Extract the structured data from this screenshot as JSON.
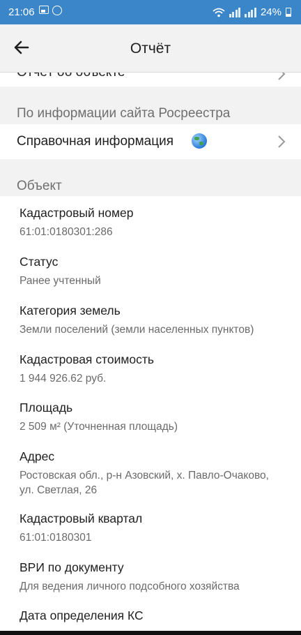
{
  "status_bar": {
    "time": "21:06",
    "battery": "24%",
    "icons": [
      "image-icon",
      "whatsapp-icon",
      "wifi-icon",
      "signal-icon",
      "battery-icon"
    ]
  },
  "app_bar": {
    "title": "Отчёт",
    "back_icon": "arrow-left-icon"
  },
  "partial_row": {
    "label": "Отчёт об объекте"
  },
  "section_rosreestr": {
    "header": "По информации сайта Росреестра",
    "item_label": "Справочная информация",
    "item_icon": "globe-icon"
  },
  "section_object": {
    "header": "Объект",
    "fields": [
      {
        "label": "Кадастровый номер",
        "value": "61:01:0180301:286"
      },
      {
        "label": "Статус",
        "value": "Ранее учтенный"
      },
      {
        "label": "Категория земель",
        "value": "Земли поселений (земли населенных пунктов)"
      },
      {
        "label": "Кадастровая стоимость",
        "value": "1 944 926.62 руб."
      },
      {
        "label": "Площадь",
        "value": "2 509 м² (Уточненная площадь)"
      },
      {
        "label": "Адрес",
        "value": "Ростовская обл., р-н Азовский, х. Павло-Очаково,\nул. Светлая, 26"
      },
      {
        "label": "Кадастровый квартал",
        "value": "61:01:0180301"
      },
      {
        "label": "ВРИ по документу",
        "value": "Для ведения личного подсобного хозяйства"
      },
      {
        "label": "Дата определения КС",
        "value": ""
      }
    ]
  },
  "colors": {
    "status_bar_bg": "#3a86c8",
    "page_bg": "#f2f2f2",
    "card_bg": "#ffffff",
    "section_header_text": "#6f6f6f",
    "value_text": "#6a6a6a"
  }
}
